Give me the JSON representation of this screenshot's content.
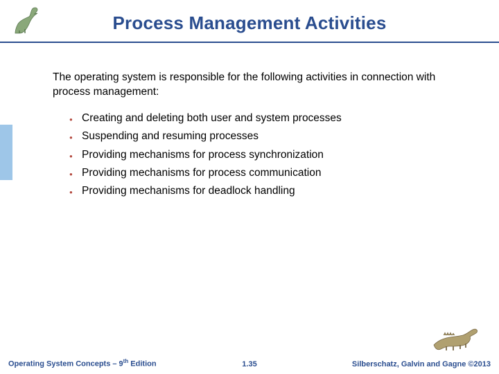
{
  "title": "Process Management Activities",
  "intro": "The operating system is responsible for the following activities in connection with process management:",
  "bullets": [
    "Creating and deleting both user and system processes",
    "Suspending and resuming processes",
    "Providing mechanisms for process synchronization",
    "Providing mechanisms for process communication",
    "Providing mechanisms for deadlock handling"
  ],
  "footer": {
    "left_prefix": "Operating System Concepts – 9",
    "left_suffix": " Edition",
    "left_sup": "th",
    "center": "1.35",
    "right": "Silberschatz, Galvin and Gagne ©2013"
  }
}
